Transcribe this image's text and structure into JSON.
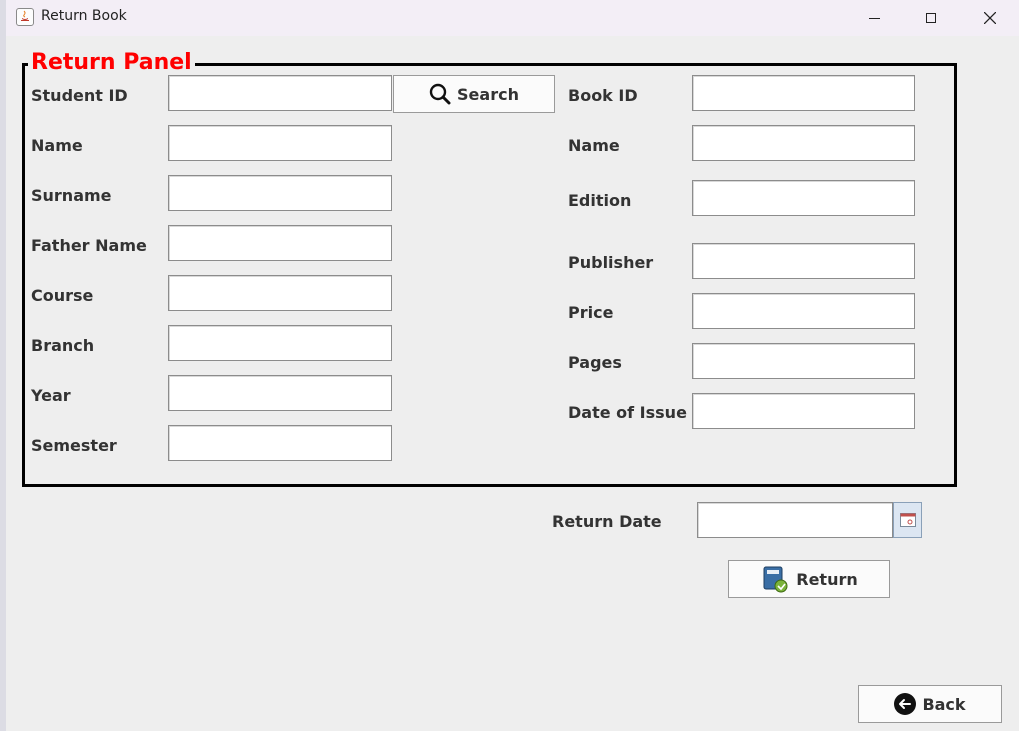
{
  "window": {
    "title": "Return Book"
  },
  "panel": {
    "title": "Return Panel"
  },
  "student": {
    "labels": [
      "Student ID",
      "Name",
      "Surname",
      "Father Name",
      "Course",
      "Branch",
      "Year",
      "Semester"
    ],
    "values": [
      "",
      "",
      "",
      "",
      "",
      "",
      "",
      ""
    ]
  },
  "search_button": {
    "label": "Search",
    "icon": "search-icon"
  },
  "book": {
    "labels": [
      "Book ID",
      "Name",
      "Edition",
      "Publisher",
      "Price",
      "Pages",
      "Date of Issue"
    ],
    "values": [
      "",
      "",
      "",
      "",
      "",
      "",
      ""
    ]
  },
  "return_date": {
    "label": "Return Date",
    "value": "",
    "icon": "calendar-icon"
  },
  "return_button": {
    "label": "Return",
    "icon": "book-return-icon"
  },
  "back_button": {
    "label": "Back",
    "icon": "back-arrow-icon"
  }
}
